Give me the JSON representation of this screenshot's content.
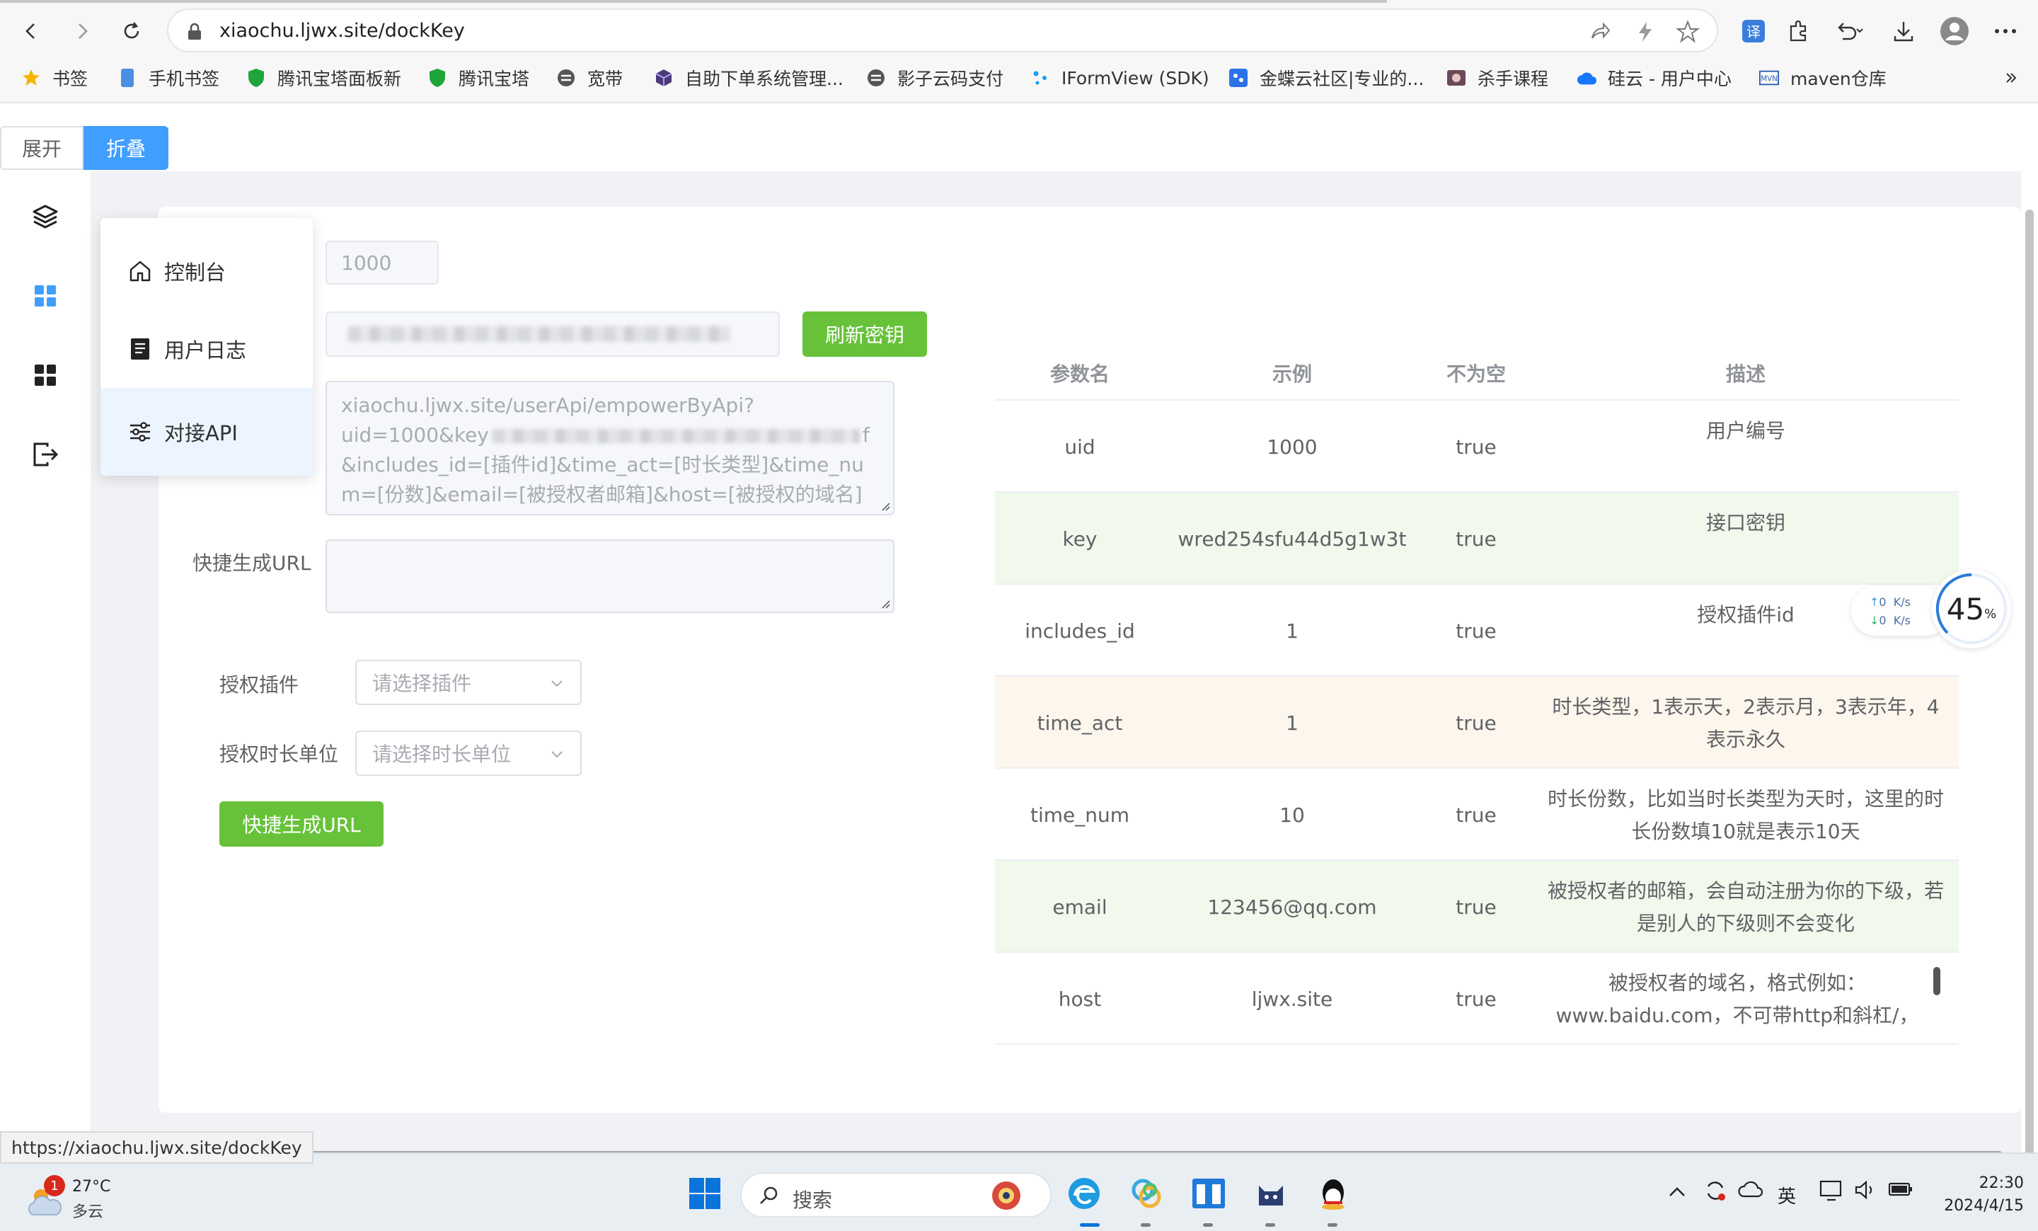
{
  "browser": {
    "url": "xiaochu.ljwx.site/dockKey",
    "status_url": "https://xiaochu.ljwx.site/dockKey",
    "bookmarks": [
      {
        "label": "书签",
        "icon": "star-icon"
      },
      {
        "label": "手机书签",
        "icon": "phone-icon"
      },
      {
        "label": "腾讯宝塔面板新",
        "icon": "shield-icon"
      },
      {
        "label": "腾讯宝塔",
        "icon": "shield-icon"
      },
      {
        "label": "宽带",
        "icon": "site-icon"
      },
      {
        "label": "自助下单系统管理...",
        "icon": "cube-icon"
      },
      {
        "label": "影子云码支付",
        "icon": "site-icon"
      },
      {
        "label": "IFormView (SDK)",
        "icon": "dots-icon"
      },
      {
        "label": "金蝶云社区|专业的...",
        "icon": "app-icon"
      },
      {
        "label": "杀手课程",
        "icon": "game-icon"
      },
      {
        "label": "硅云 - 用户中心",
        "icon": "cloud-icon"
      },
      {
        "label": "maven仓库",
        "icon": "maven-icon"
      }
    ]
  },
  "toggle": {
    "expand": "展开",
    "collapse": "折叠"
  },
  "menu": {
    "items": [
      {
        "label": "控制台",
        "icon": "home-icon"
      },
      {
        "label": "用户日志",
        "icon": "log-icon"
      },
      {
        "label": "对接API",
        "icon": "sliders-icon"
      }
    ]
  },
  "form": {
    "uid_value": "1000",
    "refresh_key_button": "刷新密钥",
    "api_url_prefix": "xiaochu.ljwx.site/userApi/empowerByApi?\nuid=1000&key",
    "api_url_key_tail": "f&",
    "api_url_rest": "includes_id=[插件id]&time_act=[时长类型]&time_num=[份数]&email=[被授权者邮箱]&host=[被授权的域名]",
    "quick_url_label": "快捷生成URL",
    "plugin_label": "授权插件",
    "plugin_placeholder": "请选择插件",
    "unit_label": "授权时长单位",
    "unit_placeholder": "请选择时长单位",
    "generate_button": "快捷生成URL"
  },
  "table": {
    "headers": [
      "参数名",
      "示例",
      "不为空",
      "描述"
    ],
    "rows": [
      {
        "name": "uid",
        "example": "1000",
        "not_null": "true",
        "desc": "用户编号"
      },
      {
        "name": "key",
        "example": "wred254sfu44d5g1w3t",
        "not_null": "true",
        "desc": "接口密钥"
      },
      {
        "name": "includes_id",
        "example": "1",
        "not_null": "true",
        "desc": "授权插件id"
      },
      {
        "name": "time_act",
        "example": "1",
        "not_null": "true",
        "desc": "时长类型，1表示天，2表示月，3表示年，4表示永久"
      },
      {
        "name": "time_num",
        "example": "10",
        "not_null": "true",
        "desc": "时长份数，比如当时长类型为天时，这里的时长份数填10就是表示10天"
      },
      {
        "name": "email",
        "example": "123456@qq.com",
        "not_null": "true",
        "desc": "被授权者的邮箱，会自动注册为你的下级，若是别人的下级则不会变化"
      },
      {
        "name": "host",
        "example": "ljwx.site",
        "not_null": "true",
        "desc": "被授权者的域名，格式例如：www.baidu.com，不可带http和斜杠/，"
      }
    ]
  },
  "speed_widget": {
    "up": "0",
    "down": "0",
    "unit": "K/s",
    "percent": "45",
    "percent_sign": "%"
  },
  "taskbar": {
    "weather_temp": "27°C",
    "weather_desc": "多云",
    "weather_badge": "1",
    "search_placeholder": "搜索",
    "ime": "英",
    "time": "22:30",
    "date": "2024/4/15"
  },
  "colors": {
    "primary": "#409eff",
    "success": "#67c23a",
    "row_green": "#f0f9eb",
    "row_orange": "#fdf6ec"
  }
}
